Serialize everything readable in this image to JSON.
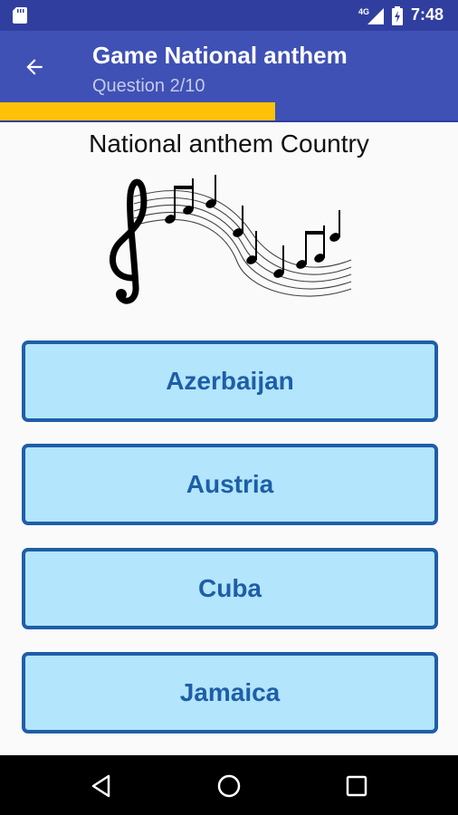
{
  "status_bar": {
    "network": "4G",
    "time": "7:48",
    "icons": [
      "sd-card-icon",
      "signal-icon",
      "battery-icon"
    ]
  },
  "app_bar": {
    "title": "Game National anthem",
    "subtitle": "Question 2/10",
    "back_icon": "arrow-back-icon"
  },
  "progress": {
    "value": 0.6
  },
  "question": {
    "text": "National anthem Country",
    "image_icon": "music-notes-icon"
  },
  "answers": [
    {
      "label": "Azerbaijan"
    },
    {
      "label": "Austria"
    },
    {
      "label": "Cuba"
    },
    {
      "label": "Jamaica"
    }
  ],
  "nav_bar": {
    "icons": [
      "back-triangle-icon",
      "home-circle-icon",
      "recents-square-icon"
    ]
  },
  "colors": {
    "primary": "#3f51b5",
    "primary_dark": "#303f9f",
    "accent": "#ffc107",
    "answer_fill": "#b3e5fc",
    "answer_border": "#1e5ea8"
  }
}
